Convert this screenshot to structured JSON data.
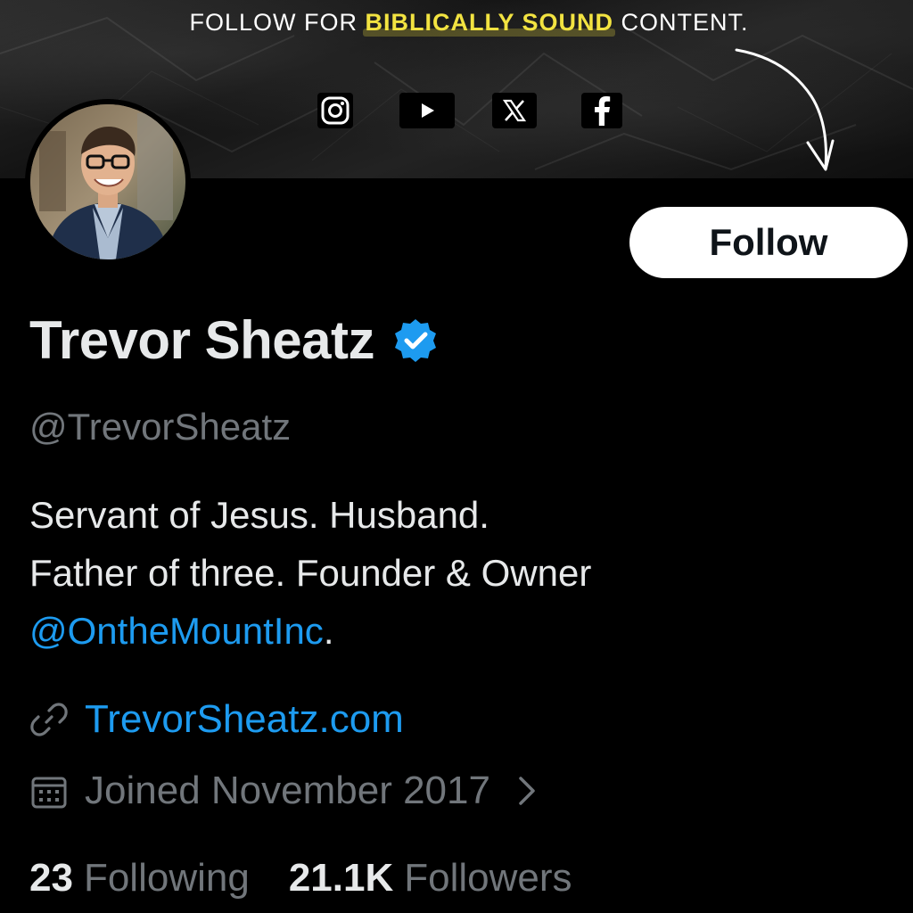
{
  "banner": {
    "tagline_before": "FOLLOW FOR ",
    "tagline_highlight": "BIBLICALLY SOUND",
    "tagline_after": " CONTENT.",
    "highlight_color": "#f2e341",
    "social_icons": [
      "instagram-icon",
      "youtube-icon",
      "x-icon",
      "facebook-icon"
    ]
  },
  "profile": {
    "display_name": "Trevor Sheatz",
    "handle": "@TrevorSheatz",
    "verified": true,
    "bio_line1": "Servant of Jesus. Husband.",
    "bio_line2": "Father of three. Founder & Owner",
    "bio_mention": "@OntheMountInc",
    "bio_end": ".",
    "website": "TrevorSheatz.com",
    "joined": "Joined November 2017"
  },
  "actions": {
    "follow_label": "Follow"
  },
  "stats": {
    "following_count": "23",
    "following_label": "Following",
    "followers_count": "21.1K",
    "followers_label": "Followers"
  },
  "colors": {
    "background": "#000000",
    "text_primary": "#e7e9ea",
    "text_secondary": "#71767b",
    "link": "#1d9bf0",
    "follow_button_bg": "#ffffff"
  }
}
